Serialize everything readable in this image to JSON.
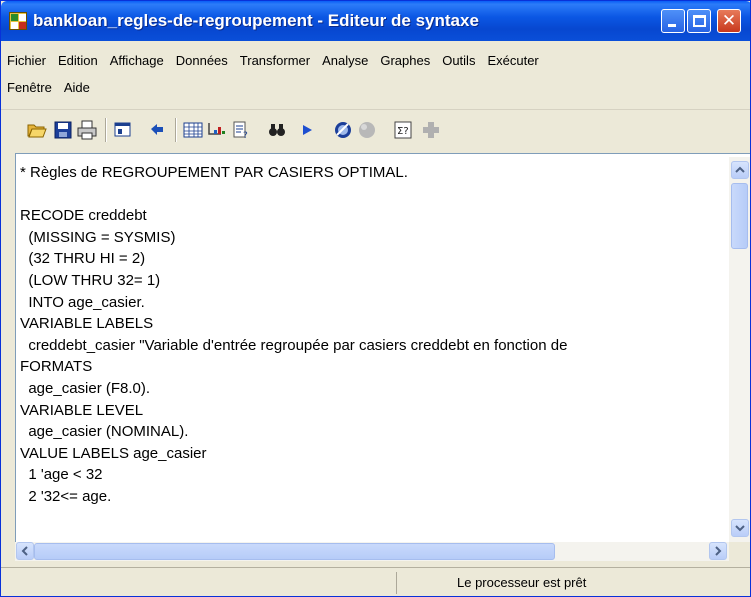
{
  "window": {
    "title": "bankloan_regles-de-regroupement - Editeur de syntaxe"
  },
  "menu": {
    "row1": [
      {
        "label": "Fichier"
      },
      {
        "label": "Edition"
      },
      {
        "label": "Affichage"
      },
      {
        "label": "Données"
      },
      {
        "label": "Transformer"
      },
      {
        "label": "Analyse"
      },
      {
        "label": "Graphes"
      },
      {
        "label": "Outils"
      },
      {
        "label": "Exécuter"
      }
    ],
    "row2": [
      {
        "label": "Fenêtre"
      },
      {
        "label": "Aide"
      }
    ]
  },
  "toolbar": {
    "icons": [
      "open-folder-icon",
      "save-icon",
      "print-icon",
      "dialog-recall-icon",
      "undo-icon",
      "data-editor-icon",
      "goto-case-icon",
      "variables-icon",
      "find-icon",
      "run-icon",
      "designate-window-icon",
      "stop-icon",
      "syntax-help-icon",
      "add-icon"
    ]
  },
  "editor": {
    "lines": [
      "* Règles de REGROUPEMENT PAR CASIERS OPTIMAL.",
      "",
      "RECODE creddebt",
      "  (MISSING = SYSMIS)",
      "  (32 THRU HI = 2)",
      "  (LOW THRU 32= 1)",
      "  INTO age_casier.",
      "VARIABLE LABELS",
      "  creddebt_casier \"Variable d'entrée regroupée par casiers creddebt en fonction de",
      "FORMATS",
      "  age_casier (F8.0).",
      "VARIABLE LEVEL",
      "  age_casier (NOMINAL).",
      "VALUE LABELS age_casier",
      "  1 'age < 32",
      "  2 '32<= age."
    ]
  },
  "status": {
    "text": "Le processeur est prêt"
  },
  "colors": {
    "titlebar": "#0b57e4",
    "chrome": "#ece9d8",
    "scrollbar": "#b9cdf8"
  }
}
